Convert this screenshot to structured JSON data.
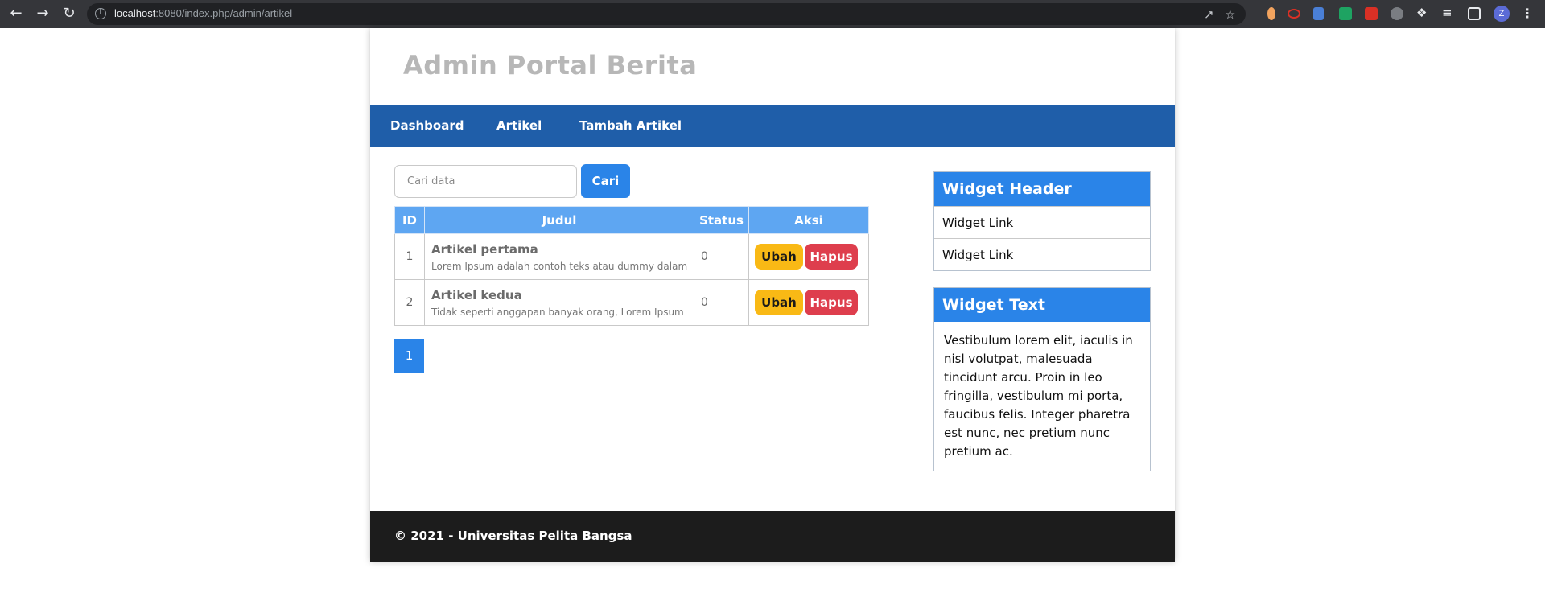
{
  "browser": {
    "url_host": "localhost",
    "url_rest": ":8080/index.php/admin/artikel",
    "profile_initial": "Z"
  },
  "site": {
    "title": "Admin Portal Berita"
  },
  "nav": {
    "items": [
      {
        "label": "Dashboard"
      },
      {
        "label": "Artikel"
      },
      {
        "label": "Tambah Artikel"
      }
    ]
  },
  "search": {
    "placeholder": "Cari data",
    "button_label": "Cari"
  },
  "table": {
    "headers": [
      "ID",
      "Judul",
      "Status",
      "Aksi"
    ],
    "rows": [
      {
        "id": "1",
        "title": "Artikel pertama",
        "snippet": "Lorem Ipsum adalah contoh teks atau dummy dalam",
        "status": "0",
        "edit": "Ubah",
        "delete": "Hapus"
      },
      {
        "id": "2",
        "title": "Artikel kedua",
        "snippet": "Tidak seperti anggapan banyak orang, Lorem Ipsum",
        "status": "0",
        "edit": "Ubah",
        "delete": "Hapus"
      }
    ]
  },
  "pagination": {
    "current": "1"
  },
  "widget_links": {
    "header": "Widget Header",
    "links": [
      "Widget Link",
      "Widget Link"
    ]
  },
  "widget_text": {
    "header": "Widget Text",
    "body": "Vestibulum lorem elit, iaculis in nisl volutpat, malesuada tincidunt arcu. Proin in leo fringilla, vestibulum mi porta, faucibus felis. Integer pharetra est nunc, nec pretium nunc pretium ac."
  },
  "footer": {
    "text": "© 2021 - Universitas Pelita Bangsa"
  },
  "colors": {
    "nav_bg": "#1f5ea9",
    "primary": "#2a84e8",
    "table_header": "#5ea6f2",
    "edit_button": "#f9b915",
    "delete_button": "#de3e4d",
    "footer_bg": "#1c1c1c"
  }
}
